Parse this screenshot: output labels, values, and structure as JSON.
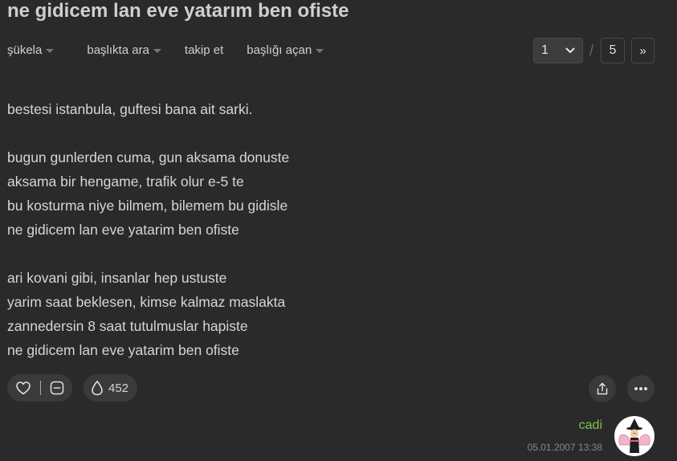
{
  "topic": {
    "title": "ne gidicem lan eve yatarım ben ofiste"
  },
  "subnav": {
    "items": [
      {
        "label": "şükela",
        "has_caret": true
      },
      {
        "label": "başlıkta ara",
        "has_caret": true
      },
      {
        "label": "takip et",
        "has_caret": false
      },
      {
        "label": "başlığı açan",
        "has_caret": true
      }
    ]
  },
  "pager": {
    "current_page": "1",
    "separator": "/",
    "total_pages": "5",
    "next_label": "»"
  },
  "entry": {
    "lines": [
      "bestesi istanbula, guftesi bana ait sarki.",
      "",
      "bugun gunlerden cuma, gun aksama donuste",
      "aksama bir hengame, trafik olur e-5 te",
      "bu kosturma niye bilmem, bilemem bu gidisle",
      "ne gidicem lan eve yatarim ben ofiste",
      "",
      "ari kovani gibi, insanlar hep ustuste",
      "yarim saat beklesen, kimse kalmaz maslakta",
      "zannedersin 8 saat tutulmuslar hapiste",
      "ne gidicem lan eve yatarim ben ofiste"
    ],
    "favorite_count": "452",
    "author": "cadi",
    "date": "05.01.2007 13:38"
  },
  "icons": {
    "like": "heart-icon",
    "dislike": "minus-box-icon",
    "favorite": "drop-icon",
    "share": "share-icon",
    "more": "more-dots-icon",
    "page_dropdown": "chevron-down-icon"
  },
  "colors": {
    "background": "#2a2a2a",
    "text": "#d4d4d4",
    "author": "#81c14b",
    "date": "#888888",
    "pill": "#3a3a3a"
  }
}
